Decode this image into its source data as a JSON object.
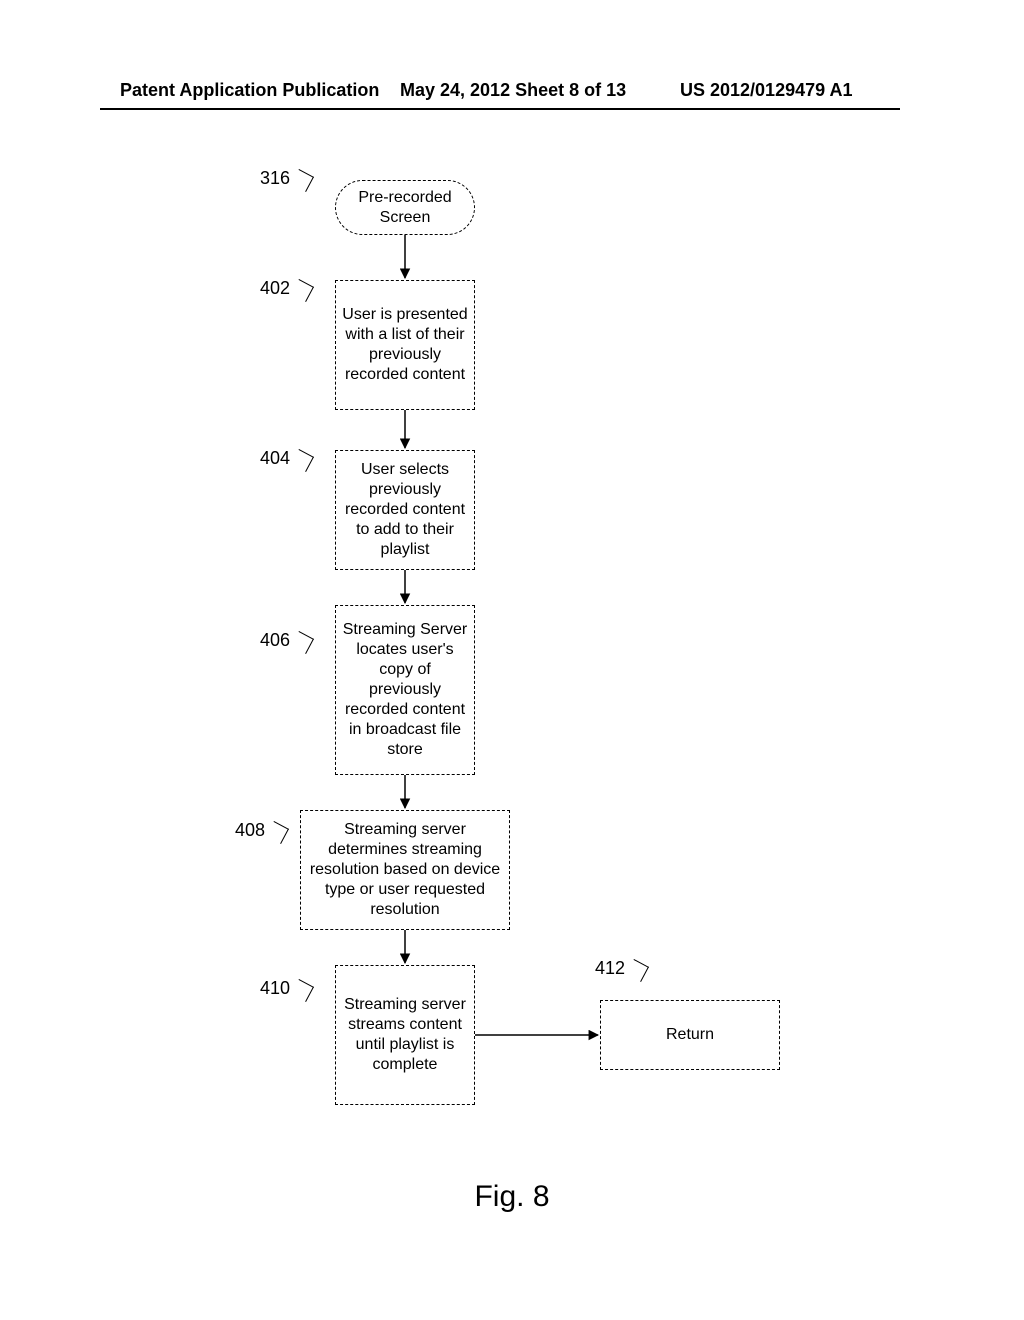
{
  "header": {
    "left": "Patent Application Publication",
    "mid": "May 24, 2012  Sheet 8 of 13",
    "right": "US 2012/0129479 A1"
  },
  "figure_caption": "Fig. 8",
  "nodes": {
    "n316": {
      "ref": "316",
      "text": "Pre-recorded Screen"
    },
    "n402": {
      "ref": "402",
      "text": "User is presented with a list of their previously recorded content"
    },
    "n404": {
      "ref": "404",
      "text": "User selects previously recorded content to add to their playlist"
    },
    "n406": {
      "ref": "406",
      "text": "Streaming Server locates user's copy of previously recorded content in broadcast file store"
    },
    "n408": {
      "ref": "408",
      "text": "Streaming server determines streaming resolution based on device type or user requested resolution"
    },
    "n410": {
      "ref": "410",
      "text": "Streaming server streams content until playlist is complete"
    },
    "n412": {
      "ref": "412",
      "text": "Return"
    }
  }
}
